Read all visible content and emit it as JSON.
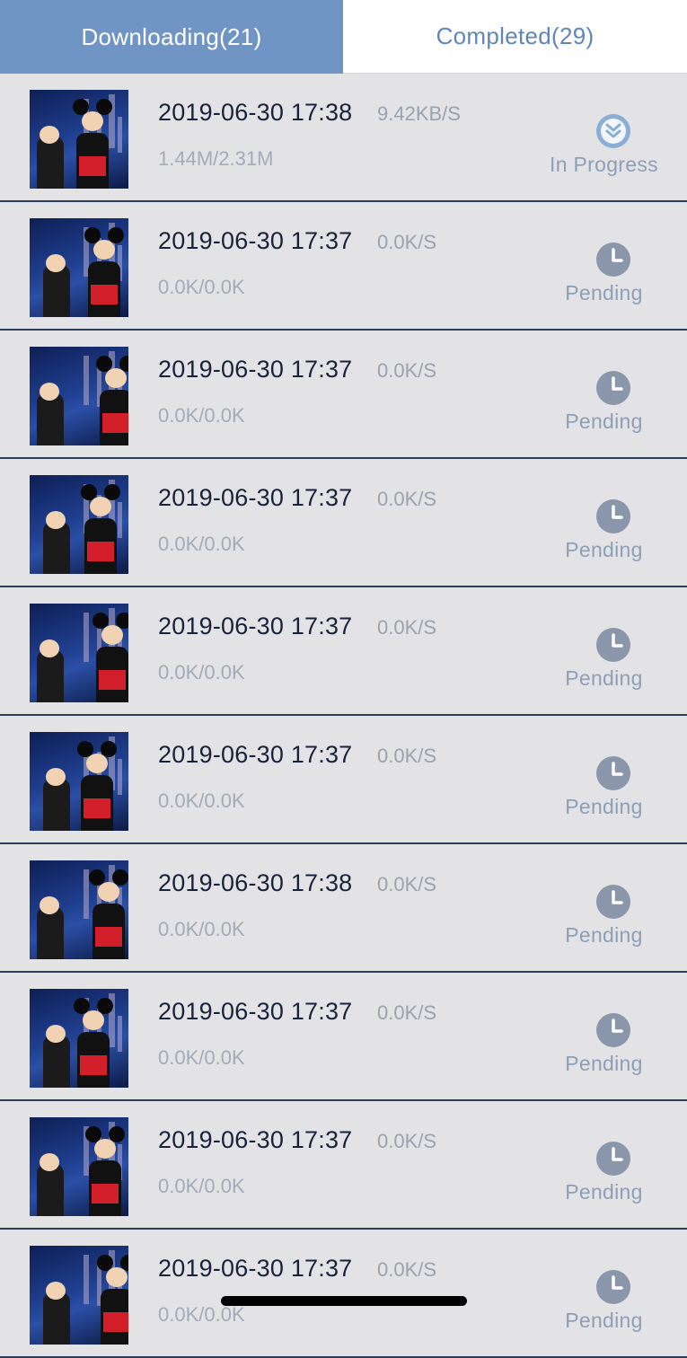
{
  "tabs": {
    "downloading_label": "Downloading(21)",
    "completed_label": "Completed(29)"
  },
  "colors": {
    "active_tab": "#7095c4",
    "inactive_tab_text": "#5f86b8",
    "row_background": "#e3e3e5",
    "status_icon": "#8a96aa",
    "in_progress_icon": "#8aaed6"
  },
  "downloads": [
    {
      "datetime": "2019-06-30 17:38",
      "speed": "9.42KB/S",
      "progress": "1.44M/2.31M",
      "status": "In Progress",
      "icon": "double-chevron-down-icon"
    },
    {
      "datetime": "2019-06-30 17:37",
      "speed": "0.0K/S",
      "progress": "0.0K/0.0K",
      "status": "Pending",
      "icon": "clock-icon"
    },
    {
      "datetime": "2019-06-30 17:37",
      "speed": "0.0K/S",
      "progress": "0.0K/0.0K",
      "status": "Pending",
      "icon": "clock-icon"
    },
    {
      "datetime": "2019-06-30 17:37",
      "speed": "0.0K/S",
      "progress": "0.0K/0.0K",
      "status": "Pending",
      "icon": "clock-icon"
    },
    {
      "datetime": "2019-06-30 17:37",
      "speed": "0.0K/S",
      "progress": "0.0K/0.0K",
      "status": "Pending",
      "icon": "clock-icon"
    },
    {
      "datetime": "2019-06-30 17:37",
      "speed": "0.0K/S",
      "progress": "0.0K/0.0K",
      "status": "Pending",
      "icon": "clock-icon"
    },
    {
      "datetime": "2019-06-30 17:38",
      "speed": "0.0K/S",
      "progress": "0.0K/0.0K",
      "status": "Pending",
      "icon": "clock-icon"
    },
    {
      "datetime": "2019-06-30 17:37",
      "speed": "0.0K/S",
      "progress": "0.0K/0.0K",
      "status": "Pending",
      "icon": "clock-icon"
    },
    {
      "datetime": "2019-06-30 17:37",
      "speed": "0.0K/S",
      "progress": "0.0K/0.0K",
      "status": "Pending",
      "icon": "clock-icon"
    },
    {
      "datetime": "2019-06-30 17:37",
      "speed": "0.0K/S",
      "progress": "0.0K/0.0K",
      "status": "Pending",
      "icon": "clock-icon"
    }
  ]
}
